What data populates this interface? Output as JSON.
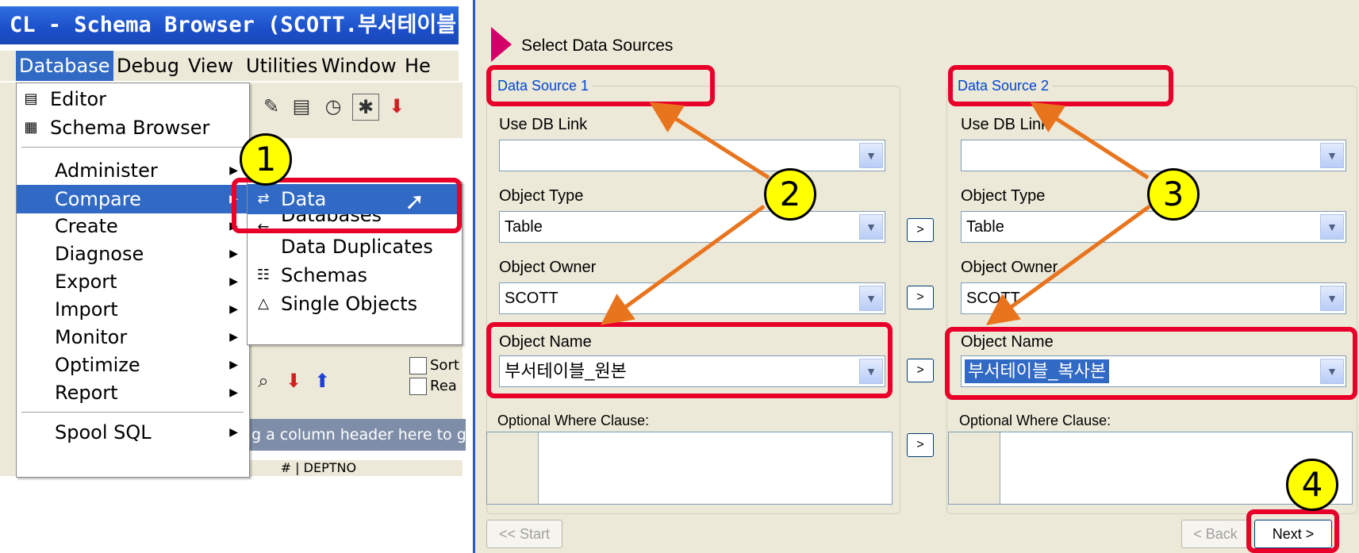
{
  "left_window": {
    "title": "CL - Schema Browser (SCOTT.부서테이블",
    "menubar": [
      "Database",
      "Debug",
      "View",
      "Utilities",
      "Window",
      "He"
    ],
    "database_menu": {
      "top_items": [
        "Editor",
        "Schema Browser"
      ],
      "items": [
        "Administer",
        "Compare",
        "Create",
        "Diagnose",
        "Export",
        "Import",
        "Monitor",
        "Optimize",
        "Report"
      ],
      "bottom_items": [
        "Spool SQL"
      ],
      "highlighted": "Compare"
    },
    "compare_submenu": {
      "items": [
        "Data",
        "Databases",
        "Data Duplicates",
        "Schemas",
        "Single Objects"
      ],
      "highlighted": "Data"
    },
    "toolbar_labels": {
      "sort": "Sort",
      "read": "Rea"
    },
    "group_hint": "g a column header here to gr",
    "grid_header": "DEPTNO"
  },
  "wizard": {
    "title": "Select Data Sources",
    "source1": {
      "caption": "Data Source 1",
      "db_link_label": "Use DB Link",
      "db_link_value": "",
      "object_type_label": "Object Type",
      "object_type_value": "Table",
      "object_owner_label": "Object Owner",
      "object_owner_value": "SCOTT",
      "object_name_label": "Object Name",
      "object_name_value": "부서테이블_원본",
      "where_label": "Optional Where Clause:"
    },
    "source2": {
      "caption": "Data Source 2",
      "db_link_label": "Use DB Link",
      "db_link_value": "",
      "object_type_label": "Object Type",
      "object_type_value": "Table",
      "object_owner_label": "Object Owner",
      "object_owner_value": "SCOTT",
      "object_name_label": "Object Name",
      "object_name_value": "부서테이블_복사본",
      "where_label": "Optional Where Clause:"
    },
    "copy_button": ">",
    "buttons": {
      "start": "<< Start",
      "back": "< Back",
      "next": "Next >"
    }
  },
  "annotations": {
    "step1": "1",
    "step2": "2",
    "step3": "3",
    "step4": "4"
  },
  "colors": {
    "callout": "#e8002a",
    "badge": "#ffff00",
    "arrow": "#e8741e",
    "highlight": "#316ac5"
  }
}
